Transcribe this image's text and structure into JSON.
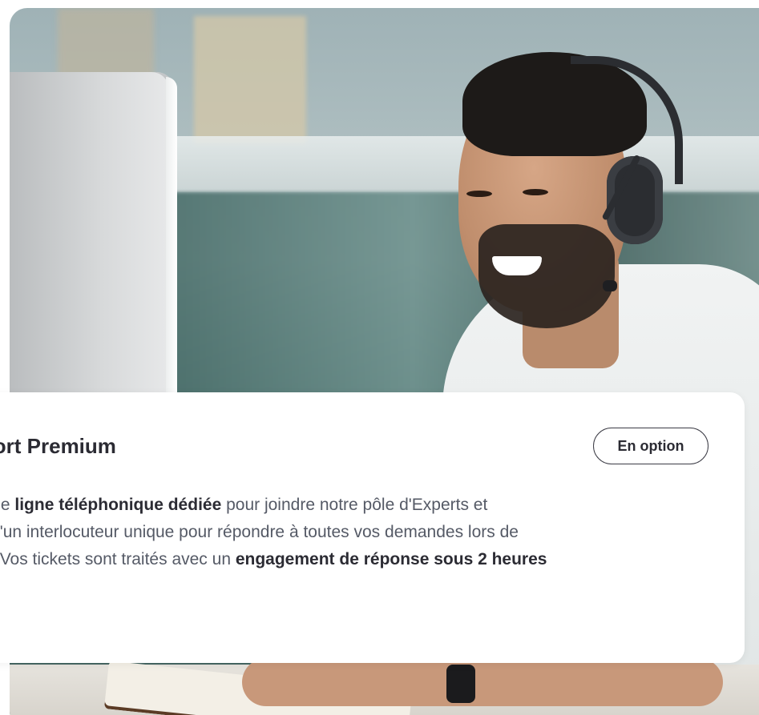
{
  "card": {
    "title": "pport Premium",
    "badge": "En option",
    "lines": [
      {
        "pre": "à une ",
        "bold": "ligne téléphonique dédiée",
        "post": " pour joindre notre pôle d'Experts et"
      },
      {
        "text": "ez d'un interlocuteur unique pour répondre à toutes vos demandes lors de"
      },
      {
        "pre": "pel. Vos tickets sont traités avec un ",
        "bold": "engagement de réponse sous 2 heures"
      }
    ]
  },
  "colors": {
    "title": "#2b2b33",
    "body": "#555a66",
    "card_bg": "#ffffff",
    "badge_border": "#3b3b45"
  }
}
